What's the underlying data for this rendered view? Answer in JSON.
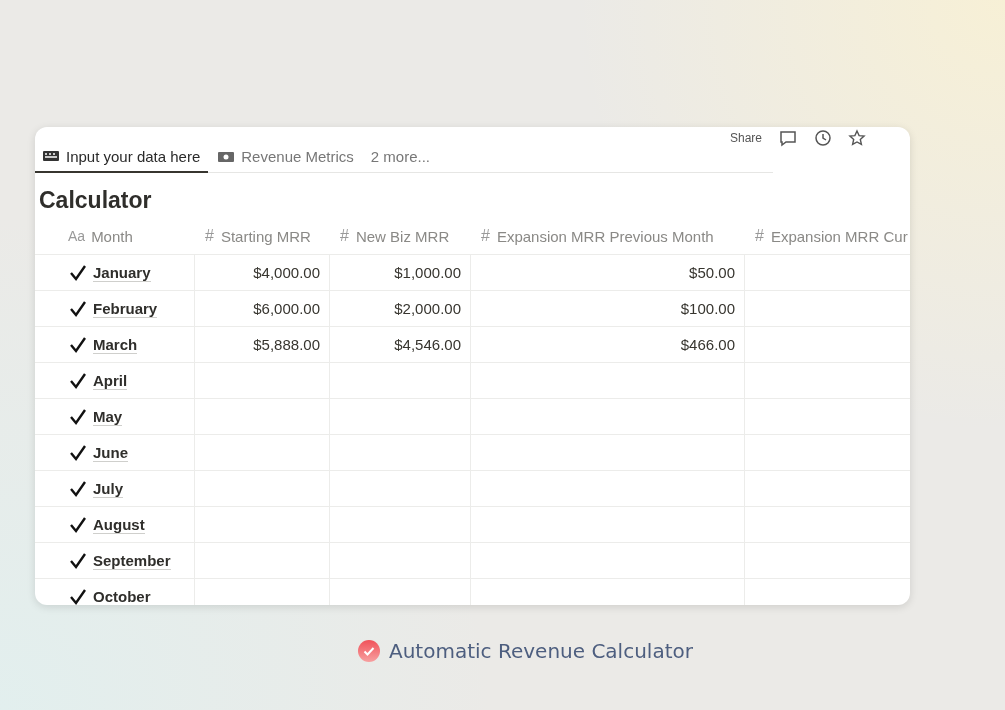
{
  "topbar": {
    "share": "Share"
  },
  "tabs": [
    {
      "label": "Input your data here",
      "selected": true
    },
    {
      "label": "Revenue Metrics",
      "selected": false
    },
    {
      "label": "2 more...",
      "selected": false
    }
  ],
  "title": "Calculator",
  "table": {
    "columns": [
      {
        "icon": "Aa",
        "label": "Month",
        "kind": "title"
      },
      {
        "icon": "#",
        "label": "Starting MRR",
        "kind": "number"
      },
      {
        "icon": "#",
        "label": "New Biz MRR",
        "kind": "number"
      },
      {
        "icon": "#",
        "label": "Expansion MRR Previous Month",
        "kind": "number"
      },
      {
        "icon": "#",
        "label": "Expansion MRR Cur",
        "kind": "number"
      }
    ],
    "rows": [
      {
        "month": "January",
        "checked": true,
        "values": [
          "$4,000.00",
          "$1,000.00",
          "$50.00"
        ]
      },
      {
        "month": "February",
        "checked": true,
        "values": [
          "$6,000.00",
          "$2,000.00",
          "$100.00"
        ]
      },
      {
        "month": "March",
        "checked": true,
        "values": [
          "$5,888.00",
          "$4,546.00",
          "$466.00"
        ]
      },
      {
        "month": "April",
        "checked": true
      },
      {
        "month": "May",
        "checked": true
      },
      {
        "month": "June",
        "checked": true
      },
      {
        "month": "July",
        "checked": true
      },
      {
        "month": "August",
        "checked": true
      },
      {
        "month": "September",
        "checked": true
      },
      {
        "month": "October",
        "checked": true
      }
    ]
  },
  "caption": "Automatic Revenue Calculator"
}
